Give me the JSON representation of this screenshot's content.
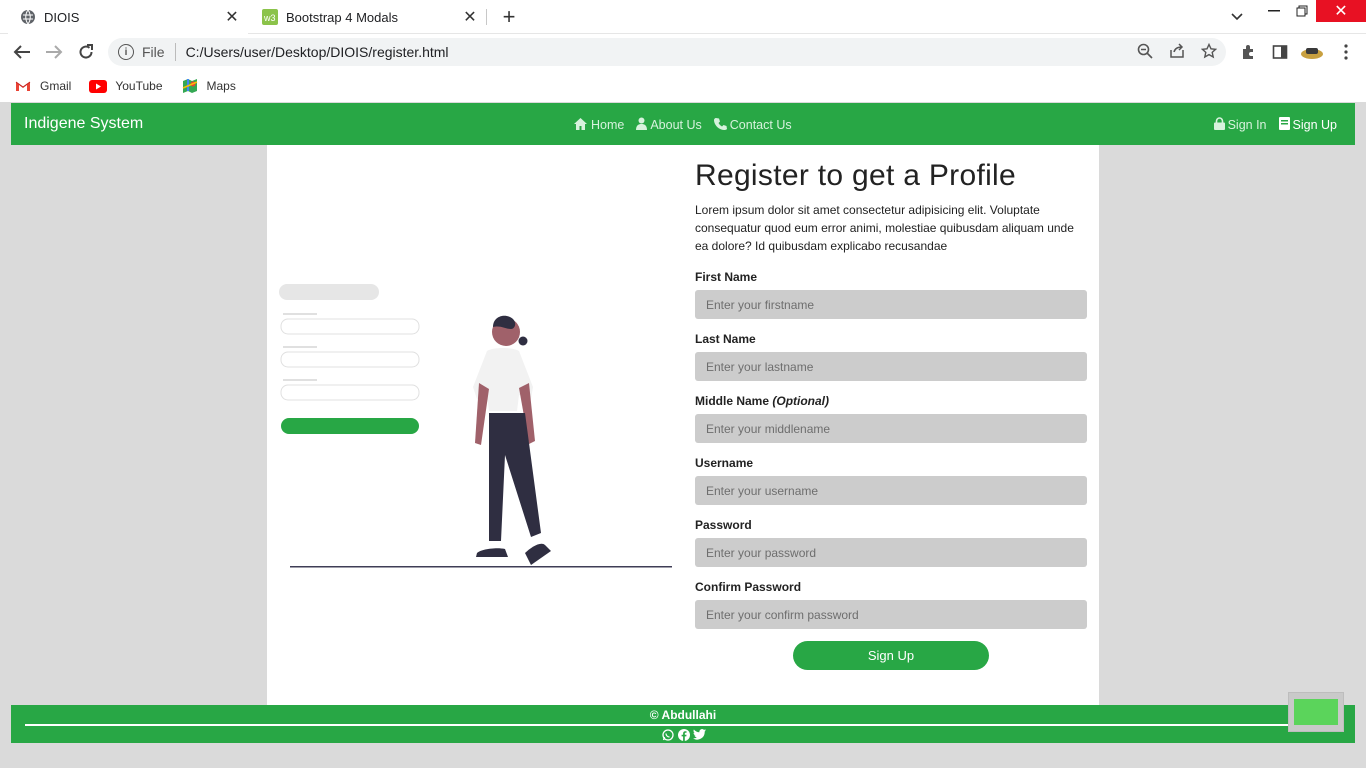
{
  "browser": {
    "tabs": [
      {
        "title": "DIOIS",
        "icon": "globe-icon",
        "active": true
      },
      {
        "title": "Bootstrap 4 Modals",
        "icon": "w3schools-icon",
        "active": false
      }
    ],
    "address": {
      "scheme_label": "File",
      "url": "C:/Users/user/Desktop/DIOIS/register.html"
    },
    "bookmarks": [
      {
        "label": "Gmail",
        "icon": "gmail-icon"
      },
      {
        "label": "YouTube",
        "icon": "youtube-icon"
      },
      {
        "label": "Maps",
        "icon": "maps-icon"
      }
    ]
  },
  "navbar": {
    "brand": "Indigene System",
    "links": [
      {
        "label": "Home",
        "icon": "home-icon"
      },
      {
        "label": "About Us",
        "icon": "user-icon"
      },
      {
        "label": "Contact Us",
        "icon": "phone-icon"
      }
    ],
    "signin": {
      "label": "Sign In",
      "icon": "lock-icon"
    },
    "signup": {
      "label": "Sign Up",
      "icon": "book-icon"
    }
  },
  "form": {
    "title": "Register to get a Profile",
    "description": "Lorem ipsum dolor sit amet consectetur adipisicing elit. Voluptate consequatur quod eum error animi, molestiae quibusdam aliquam unde ea dolore? Id quibusdam explicabo recusandae",
    "fields": [
      {
        "label": "First Name",
        "placeholder": "Enter your firstname"
      },
      {
        "label": "Last Name",
        "placeholder": "Enter your lastname"
      },
      {
        "label": "Middle Name",
        "optional": "(Optional)",
        "placeholder": "Enter your middlename"
      },
      {
        "label": "Username",
        "placeholder": "Enter your username"
      },
      {
        "label": "Password",
        "placeholder": "Enter your password"
      },
      {
        "label": "Confirm Password",
        "placeholder": "Enter your confirm password"
      }
    ],
    "submit": "Sign Up"
  },
  "footer": {
    "copyright": "© Abdullahi",
    "social": [
      "whatsapp-icon",
      "facebook-icon",
      "twitter-icon"
    ]
  },
  "colors": {
    "accent": "#28a745",
    "page_bg": "#dadada",
    "input_bg": "#cccccc"
  }
}
